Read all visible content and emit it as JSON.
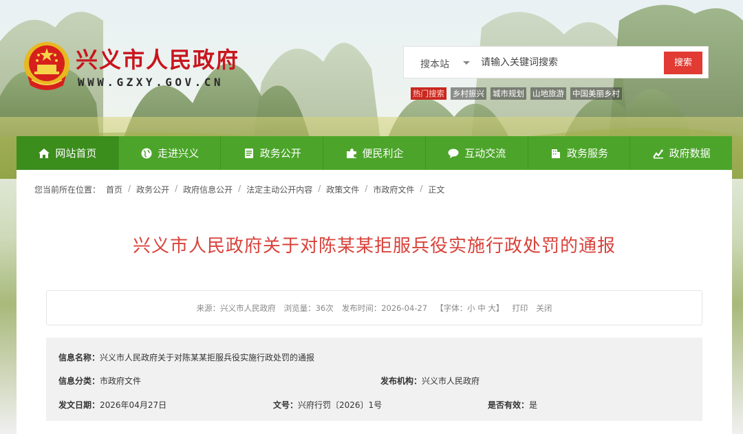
{
  "site": {
    "title": "兴义市人民政府",
    "domain": "WWW.GZXY.GOV.CN"
  },
  "search": {
    "scope_label": "搜本站",
    "placeholder": "请输入关键词搜索",
    "button_label": "搜索"
  },
  "hot_tags": [
    "热门搜索",
    "乡村振兴",
    "城市规划",
    "山地旅游",
    "中国美丽乡村"
  ],
  "nav": {
    "items": [
      {
        "label": "网站首页",
        "icon": "home-icon"
      },
      {
        "label": "走进兴义",
        "icon": "globe-icon"
      },
      {
        "label": "政务公开",
        "icon": "document-icon"
      },
      {
        "label": "便民利企",
        "icon": "puzzle-icon"
      },
      {
        "label": "互动交流",
        "icon": "chat-icon"
      },
      {
        "label": "政务服务",
        "icon": "building-icon"
      },
      {
        "label": "政府数据",
        "icon": "chart-icon"
      }
    ]
  },
  "breadcrumb": {
    "prefix": "您当前所在位置：",
    "items": [
      "首页",
      "政务公开",
      "政府信息公开",
      "法定主动公开内容",
      "政策文件",
      "市政府文件",
      "正文"
    ]
  },
  "article": {
    "title": "兴义市人民政府关于对陈某某拒服兵役实施行政处罚的通报"
  },
  "meta": {
    "source": "来源：兴义市人民政府",
    "views": "浏览量：36次",
    "published": "发布时间：2026-04-27",
    "font_size": "【字体：小  中  大】",
    "print": "打印",
    "close": "关闭"
  },
  "info": {
    "name_key": "信息名称：",
    "name_val": "兴义市人民政府关于对陈某某拒服兵役实施行政处罚的通报",
    "category_key": "信息分类：",
    "category_val": "市政府文件",
    "org_key": "发布机构：",
    "org_val": "兴义市人民政府",
    "date_key": "发文日期：",
    "date_val": "2026年04月27日",
    "docno_key": "文号：",
    "docno_val": "兴府行罚〔2026〕1号",
    "valid_key": "是否有效：",
    "valid_val": "是"
  },
  "colors": {
    "nav_green": "#4ca52a",
    "title_red": "#d8423a",
    "brand_red": "#c8151d",
    "search_red": "#e13b33"
  }
}
